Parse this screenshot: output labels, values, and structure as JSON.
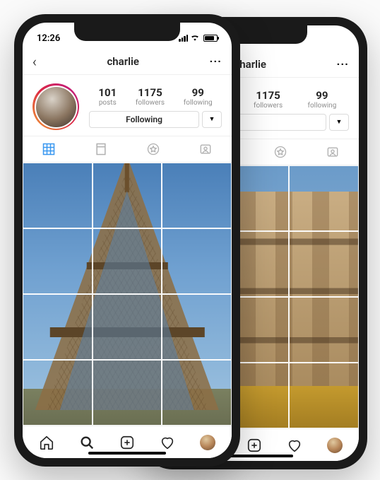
{
  "status": {
    "time": "12:26"
  },
  "phone1": {
    "username": "charlie",
    "stats": {
      "posts": {
        "value": "101",
        "label": "posts"
      },
      "followers": {
        "value": "1175",
        "label": "followers"
      },
      "following": {
        "value": "99",
        "label": "following"
      }
    },
    "followButton": "Following"
  },
  "phone2": {
    "username": "charlie",
    "stats": {
      "posts": {
        "value": "",
        "label": ""
      },
      "followers": {
        "value": "1175",
        "label": "followers"
      },
      "following": {
        "value": "99",
        "label": "following"
      }
    },
    "followButton": ""
  }
}
